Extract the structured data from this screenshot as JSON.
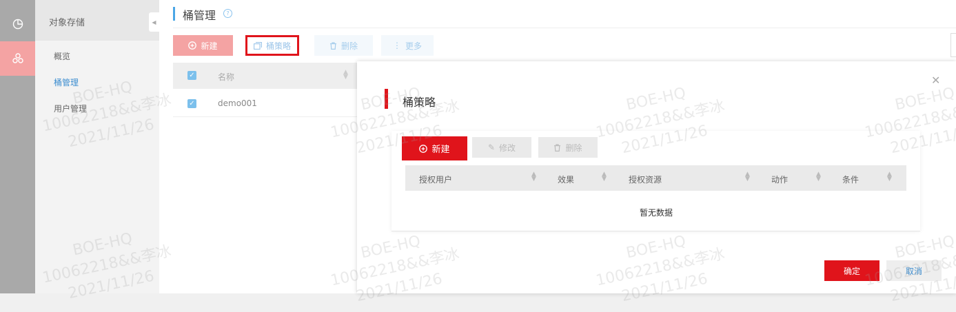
{
  "sidebar": {
    "section_title": "对象存储",
    "items": [
      {
        "label": "概览"
      },
      {
        "label": "桶管理"
      },
      {
        "label": "用户管理"
      }
    ]
  },
  "main": {
    "title": "桶管理",
    "toolbar": {
      "new_label": "新建",
      "policy_label": "桶策略",
      "delete_label": "删除",
      "more_label": "更多"
    },
    "table": {
      "columns": [
        "名称"
      ],
      "rows": [
        {
          "name": "demo001"
        }
      ]
    }
  },
  "modal": {
    "title": "桶策略",
    "new_label": "新建",
    "edit_label": "修改",
    "delete_label": "删除",
    "columns": [
      "授权用户",
      "效果",
      "授权资源",
      "动作",
      "条件"
    ],
    "empty_text": "暂无数据",
    "ok_label": "确定",
    "cancel_label": "取消"
  },
  "watermark": {
    "line1": "BOE-HQ",
    "line2": "10062218&&李冰",
    "line3": "2021/11/26"
  },
  "colors": {
    "accent_red": "#e0141b",
    "link_blue": "#3e8ed0",
    "rail_gray": "#a9a9a9"
  }
}
